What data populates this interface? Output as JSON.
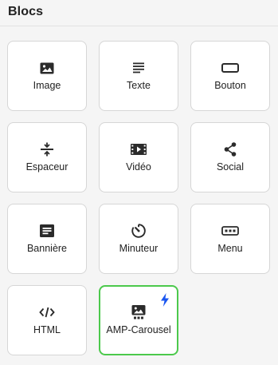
{
  "panel": {
    "title": "Blocs"
  },
  "colors": {
    "tile_border": "#d6d6d6",
    "selected_border": "#4cc94c",
    "bolt": "#1a56f0",
    "icon": "#2b2b2b"
  },
  "blocks": [
    {
      "label": "Image",
      "icon": "image-icon"
    },
    {
      "label": "Texte",
      "icon": "text-lines-icon"
    },
    {
      "label": "Bouton",
      "icon": "button-icon"
    },
    {
      "label": "Espaceur",
      "icon": "spacer-icon"
    },
    {
      "label": "Vidéo",
      "icon": "video-icon"
    },
    {
      "label": "Social",
      "icon": "share-icon"
    },
    {
      "label": "Bannière",
      "icon": "banner-icon"
    },
    {
      "label": "Minuteur",
      "icon": "timer-icon"
    },
    {
      "label": "Menu",
      "icon": "menu-icon"
    },
    {
      "label": "HTML",
      "icon": "code-icon"
    },
    {
      "label": "AMP-Carousel",
      "icon": "carousel-icon",
      "selected": true,
      "badge": "bolt-icon"
    }
  ]
}
